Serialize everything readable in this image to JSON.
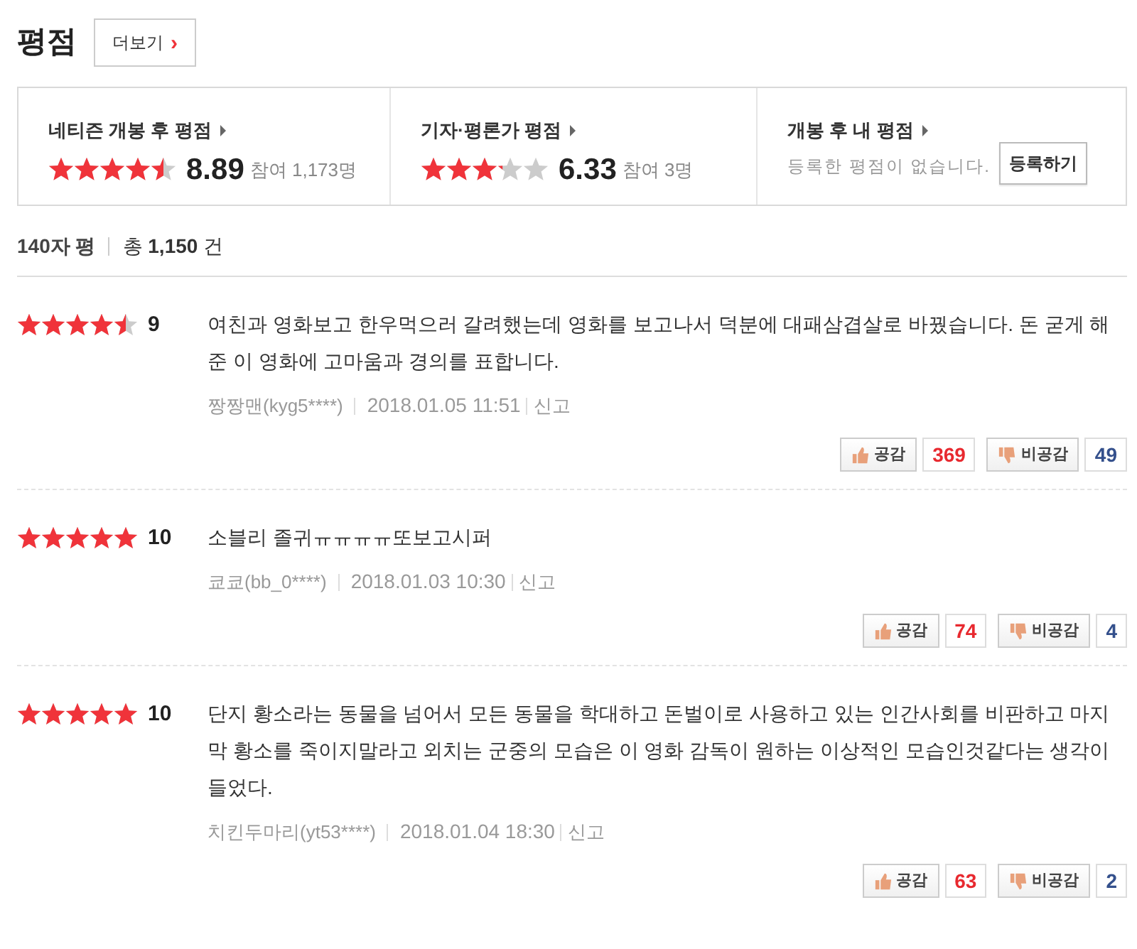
{
  "title": "평점",
  "more_button": {
    "label": "더보기",
    "arrow": "›"
  },
  "summary": [
    {
      "kind": "score",
      "label": "네티즌 개봉 후 평점",
      "stars": 4.5,
      "score": "8.89",
      "participants": "참여 1,173명"
    },
    {
      "kind": "score",
      "label": "기자·평론가 평점",
      "stars": 3.2,
      "score": "6.33",
      "participants": "참여 3명"
    },
    {
      "kind": "mine",
      "label": "개봉 후 내 평점",
      "message": "등록한 평점이 없습니다.",
      "button": "등록하기"
    }
  ],
  "list_header": {
    "label": "140자 평",
    "total_prefix": "총",
    "total": "1,150",
    "total_suffix": "건"
  },
  "reviews": [
    {
      "stars": 4.5,
      "score": "9",
      "text": "여친과 영화보고 한우먹으러 갈려했는데 영화를 보고나서 덕분에 대패삼겹살로 바꿨습니다. 돈 굳게 해준 이 영화에 고마움과 경의를 표합니다.",
      "author": "짱짱맨(kyg5****)",
      "date": "2018.01.05 11:51",
      "report": "신고",
      "like_label": "공감",
      "likes": "369",
      "dislike_label": "비공감",
      "dislikes": "49"
    },
    {
      "stars": 5,
      "score": "10",
      "text": "소블리 졸귀ㅠㅠㅠㅠ또보고시퍼",
      "author": "쿄쿄(bb_0****)",
      "date": "2018.01.03 10:30",
      "report": "신고",
      "like_label": "공감",
      "likes": "74",
      "dislike_label": "비공감",
      "dislikes": "4"
    },
    {
      "stars": 5,
      "score": "10",
      "text": "단지 황소라는 동물을 넘어서 모든 동물을 학대하고 돈벌이로 사용하고 있는 인간사회를 비판하고 마지막 황소를 죽이지말라고 외치는 군중의 모습은 이 영화 감독이 원하는 이상적인 모습인것같다는 생각이 들었다.",
      "author": "치킨두마리(yt53****)",
      "date": "2018.01.04 18:30",
      "report": "신고",
      "like_label": "공감",
      "likes": "63",
      "dislike_label": "비공감",
      "dislikes": "2"
    }
  ]
}
